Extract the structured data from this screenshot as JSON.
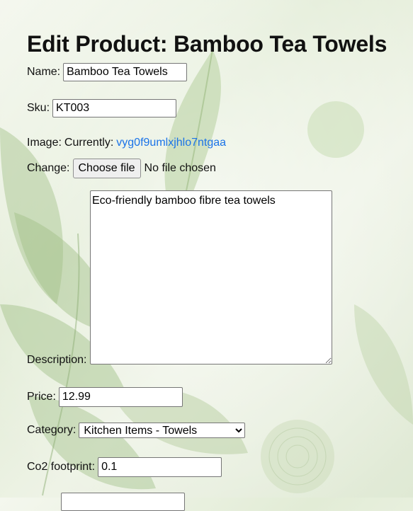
{
  "page": {
    "title": "Edit Product: Bamboo Tea Towels"
  },
  "form": {
    "name": {
      "label": "Name:",
      "value": "Bamboo Tea Towels"
    },
    "sku": {
      "label": "Sku:",
      "value": "KT003"
    },
    "image": {
      "label": "Image:",
      "currently_label": "Currently:",
      "current_file": "vyg0f9umlxjhlo7ntgaa",
      "change_label": "Change:",
      "choose_button": "Choose file",
      "no_file_text": "No file chosen"
    },
    "description": {
      "label": "Description:",
      "value": "Eco-friendly bamboo fibre tea towels"
    },
    "price": {
      "label": "Price:",
      "value": "12.99"
    },
    "category": {
      "label": "Category:",
      "selected": "Kitchen Items - Towels"
    },
    "co2": {
      "label": "Co2 footprint:",
      "value": "0.1"
    }
  },
  "colors": {
    "link": "#1a73e8",
    "background": "#e6eedb"
  }
}
